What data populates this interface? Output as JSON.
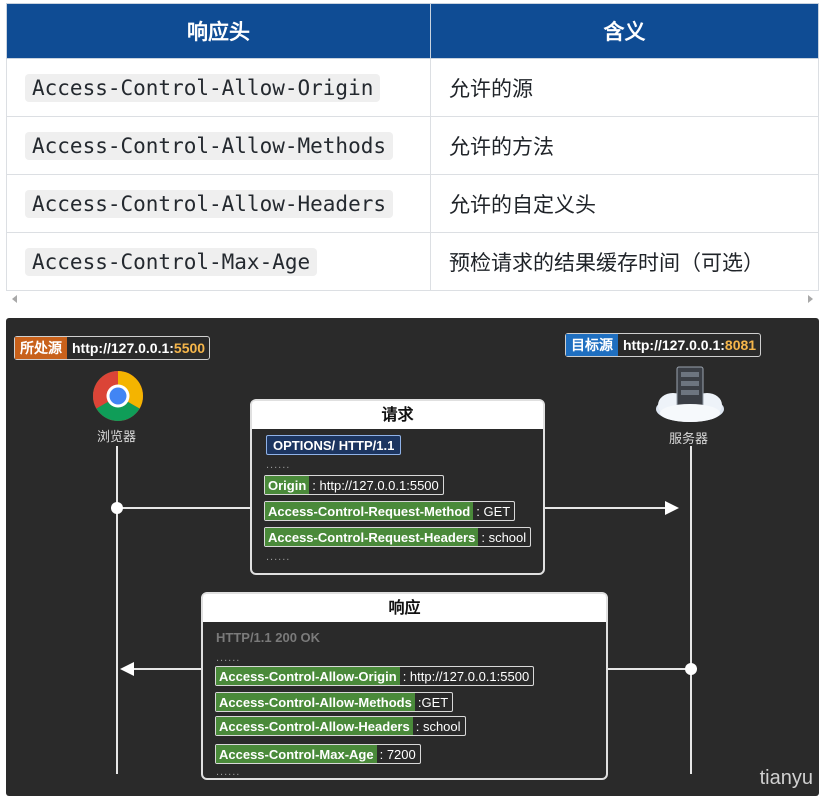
{
  "table": {
    "headers": [
      "响应头",
      "含义"
    ],
    "rows": [
      {
        "header": "Access-Control-Allow-Origin",
        "meaning": "允许的源"
      },
      {
        "header": "Access-Control-Allow-Methods",
        "meaning": "允许的方法"
      },
      {
        "header": "Access-Control-Allow-Headers",
        "meaning": "允许的自定义头"
      },
      {
        "header": "Access-Control-Max-Age",
        "meaning": "预检请求的结果缓存时间（可选）"
      }
    ]
  },
  "diagram": {
    "source": {
      "tag": "所处源",
      "url_prefix": "http://127.0.0.1:",
      "port": "5500"
    },
    "target": {
      "tag": "目标源",
      "url_prefix": "http://127.0.0.1:",
      "port": "8081"
    },
    "browser_label": "浏览器",
    "server_label": "服务器",
    "request": {
      "title": "请求",
      "start_line": "OPTIONS/ HTTP/1.1",
      "ellipsis": "......",
      "headers": [
        {
          "key": "Origin",
          "value": ": http://127.0.0.1:5500"
        },
        {
          "key": "Access-Control-Request-Method",
          "value": ": GET"
        },
        {
          "key": "Access-Control-Request-Headers",
          "value": ": school"
        }
      ]
    },
    "response": {
      "title": "响应",
      "status_line": "HTTP/1.1 200 OK",
      "ellipsis": "......",
      "headers": [
        {
          "key": "Access-Control-Allow-Origin",
          "value": ": http://127.0.0.1:5500"
        },
        {
          "key": "Access-Control-Allow-Methods",
          "value": ":GET"
        },
        {
          "key": "Access-Control-Allow-Headers",
          "value": ": school"
        },
        {
          "key": "Access-Control-Max-Age",
          "value": ": 7200"
        }
      ]
    },
    "watermark": "tianyu",
    "colors": {
      "table_header": "#0f4c94",
      "source_tag": "#c8611b",
      "target_tag": "#1f6fc0",
      "header_key": "#4a8a3a",
      "port": "#f6b64a"
    }
  }
}
